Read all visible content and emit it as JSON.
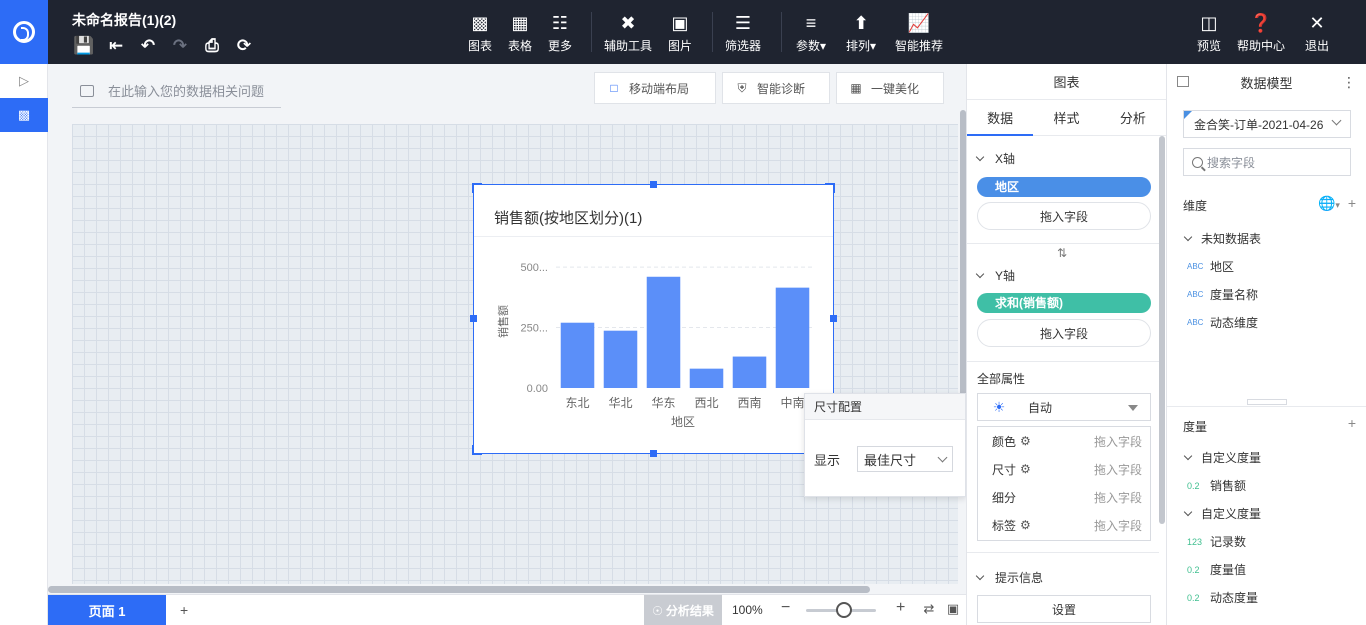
{
  "app": {
    "report_title": "未命名报告(1)(2)"
  },
  "toolbar": {
    "groups": [
      {
        "items": [
          {
            "label": "图表",
            "icon": "bar-chart-icon"
          },
          {
            "label": "表格",
            "icon": "table-icon"
          },
          {
            "label": "更多",
            "icon": "grid-icon"
          }
        ]
      },
      {
        "items": [
          {
            "label": "辅助工具",
            "icon": "tools-icon"
          },
          {
            "label": "图片",
            "icon": "image-icon"
          }
        ]
      },
      {
        "items": [
          {
            "label": "筛选器",
            "icon": "filter-icon"
          }
        ]
      },
      {
        "items": [
          {
            "label": "参数",
            "icon": "param-icon"
          },
          {
            "label": "排列",
            "icon": "arrange-icon"
          },
          {
            "label": "智能推荐",
            "icon": "smart-recommend-icon"
          }
        ]
      }
    ],
    "right": [
      {
        "label": "预览",
        "icon": "preview-icon"
      },
      {
        "label": "帮助中心",
        "icon": "help-icon"
      },
      {
        "label": "退出",
        "icon": "close-icon"
      }
    ]
  },
  "workspace": {
    "question_placeholder": "在此输入您的数据相关问题",
    "buttons": {
      "mobile_layout": "移动端布局",
      "smart_diagnosis": "智能诊断",
      "beautify": "一键美化"
    }
  },
  "chart_widget": {
    "title": "销售额(按地区划分)(1)"
  },
  "chart_data": {
    "type": "bar",
    "title": "销售额(按地区划分)(1)",
    "categories": [
      "东北",
      "华北",
      "华东",
      "西北",
      "西南",
      "中南"
    ],
    "values": [
      270,
      237,
      460,
      80,
      130,
      415
    ],
    "xlabel": "地区",
    "ylabel": "销售额",
    "yticks": [
      "0.00",
      "250...",
      "500..."
    ],
    "ytick_values": [
      0,
      250,
      500
    ],
    "ylim": [
      0,
      550
    ],
    "grid": true,
    "bar_color": "#5b8ff9"
  },
  "size_popover": {
    "title": "尺寸配置",
    "display_label": "显示",
    "display_value": "最佳尺寸"
  },
  "bottom": {
    "page_tab": "页面 1",
    "add_page": "+",
    "analysis": "分析结果",
    "zoom": "100%",
    "zoom_minus": "−",
    "zoom_plus": "+"
  },
  "props_panel": {
    "header": "图表",
    "tabs": [
      "数据",
      "样式",
      "分析"
    ],
    "x_axis": {
      "label": "X轴",
      "field": "地区",
      "drop": "拖入字段",
      "pill_color": "#4a8fe7"
    },
    "y_axis": {
      "label": "Y轴",
      "field": "求和(销售额)",
      "drop": "拖入字段",
      "pill_color": "#3fbfa6"
    },
    "all_attr": "全部属性",
    "attr_value": "自动",
    "marks": [
      {
        "name": "颜色",
        "gear": true,
        "drop": "拖入字段"
      },
      {
        "name": "尺寸",
        "gear": true,
        "drop": "拖入字段"
      },
      {
        "name": "细分",
        "gear": false,
        "drop": "拖入字段"
      },
      {
        "name": "标签",
        "gear": true,
        "drop": "拖入字段"
      }
    ],
    "tooltip_section": "提示信息",
    "settings": "设置"
  },
  "model_panel": {
    "header": "数据模型",
    "dataset": "金合笑-订单-2021-04-26",
    "search_placeholder": "搜索字段",
    "dimension_label": "维度",
    "dimension_group": "未知数据表",
    "dimensions": [
      "地区",
      "度量名称",
      "动态维度"
    ],
    "dimension_type": "ABC",
    "measure_label": "度量",
    "measure_groups": [
      {
        "name": "自定义度量",
        "fields": [
          {
            "type": "0.2",
            "name": "销售额"
          }
        ]
      },
      {
        "name": "自定义度量",
        "fields": [
          {
            "type": "123",
            "name": "记录数"
          },
          {
            "type": "0.2",
            "name": "度量值"
          },
          {
            "type": "0.2",
            "name": "动态度量"
          }
        ]
      }
    ]
  },
  "colors": {
    "accent": "#2d6cf6",
    "topbar": "#1f2430"
  }
}
